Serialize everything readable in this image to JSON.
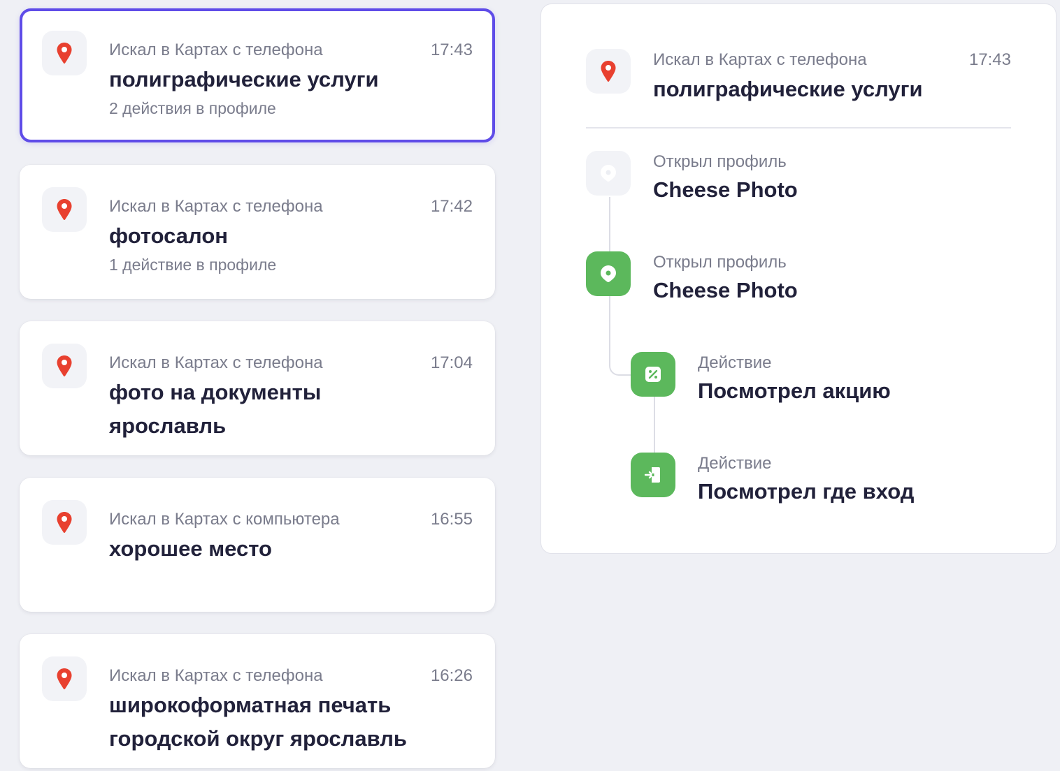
{
  "history": [
    {
      "source": "Искал в Картах с телефона",
      "time": "17:43",
      "query_lines": [
        "полиграфические услуги"
      ],
      "actions": "2 действия в профиле",
      "selected": true
    },
    {
      "source": "Искал в Картах с телефона",
      "time": "17:42",
      "query_lines": [
        "фотосалон"
      ],
      "actions": "1 действие в профиле",
      "selected": false
    },
    {
      "source": "Искал в Картах с телефона",
      "time": "17:04",
      "query_lines": [
        "фото на документы",
        "ярославль"
      ],
      "actions": "",
      "selected": false
    },
    {
      "source": "Искал в Картах с компьютера",
      "time": "16:55",
      "query_lines": [
        "хорошее место"
      ],
      "actions": "",
      "selected": false
    },
    {
      "source": "Искал в Картах с телефона",
      "time": "16:26",
      "query_lines": [
        "широкоформатная печать",
        "городской округ ярославль"
      ],
      "actions": "",
      "selected": false
    }
  ],
  "detail": {
    "source": "Искал в Картах с телефона",
    "time": "17:43",
    "query": "полиграфические услуги",
    "timeline": [
      {
        "label": "Открыл профиль",
        "title": "Cheese Photo",
        "icon": "place-pin-icon",
        "style": "grey"
      },
      {
        "label": "Открыл профиль",
        "title": "Cheese Photo",
        "icon": "place-pin-icon",
        "style": "green"
      },
      {
        "label": "Действие",
        "title": "Посмотрел акцию",
        "icon": "discount-icon",
        "style": "green"
      },
      {
        "label": "Действие",
        "title": "Посмотрел где вход",
        "icon": "entrance-icon",
        "style": "green"
      }
    ]
  },
  "colors": {
    "accent": "#5f4ce8",
    "green": "#5cb85c",
    "pin_red": "#e8402f",
    "text_secondary": "#7a7c8c"
  }
}
